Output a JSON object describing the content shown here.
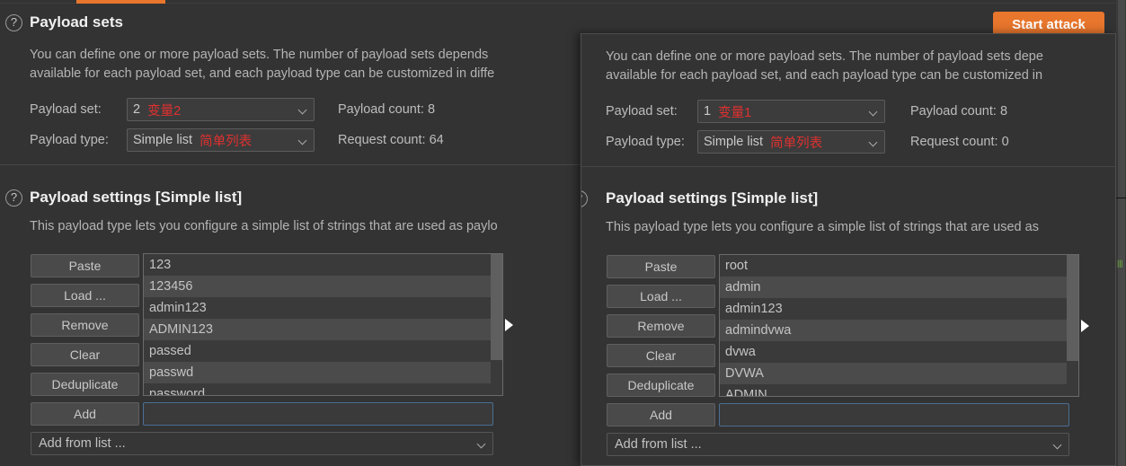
{
  "app": {
    "theme_bg": "#333333",
    "accent": "#e8762c",
    "highlight_red": "#e03030"
  },
  "toolbar": {
    "start_attack_label": "Start attack"
  },
  "base_panel": {
    "payload_sets": {
      "help_icon": "question-mark-icon",
      "title": "Payload sets",
      "description_line1": "You can define one or more payload sets. The number of payload sets depends",
      "description_line2": "available for each payload set, and each payload type can be customized in diffe",
      "payload_set_label": "Payload set:",
      "payload_set_value_num": "2",
      "payload_set_value_cn": "变量2",
      "payload_type_label": "Payload type:",
      "payload_type_value": "Simple list",
      "payload_type_value_cn": "简单列表",
      "payload_count": "Payload count: 8",
      "request_count": "Request count: 64"
    },
    "payload_settings": {
      "help_icon": "question-mark-icon",
      "title": "Payload settings [Simple list]",
      "description": "This payload type lets you configure a simple list of strings that are used as paylo",
      "buttons": [
        "Paste",
        "Load ...",
        "Remove",
        "Clear",
        "Deduplicate",
        "Add"
      ],
      "payloads": [
        "123",
        "123456",
        "admin123",
        "ADMIN123",
        "passed",
        "passwd",
        "password"
      ],
      "add_input_value": "",
      "add_from_list_label": "Add from list ...",
      "expand_icon": "triangle-right-icon"
    }
  },
  "overlay_panel": {
    "payload_sets": {
      "description_line1": "You can define one or more payload sets. The number of payload sets depe",
      "description_line2": "available for each payload set, and each payload type can be customized in",
      "payload_set_label": "Payload set:",
      "payload_set_value_num": "1",
      "payload_set_value_cn": "变量1",
      "payload_type_label": "Payload type:",
      "payload_type_value": "Simple list",
      "payload_type_value_cn": "简单列表",
      "payload_count": "Payload count: 8",
      "request_count": "Request count: 0"
    },
    "payload_settings": {
      "help_icon": "question-mark-icon",
      "title": "Payload settings [Simple list]",
      "description": "This payload type lets you configure a simple list of strings that are used as",
      "buttons": [
        "Paste",
        "Load ...",
        "Remove",
        "Clear",
        "Deduplicate",
        "Add"
      ],
      "payloads": [
        "root",
        "admin",
        "admin123",
        "admindvwa",
        "dvwa",
        "DVWA",
        "ADMIN"
      ],
      "add_input_value": "",
      "add_from_list_label": "Add from list ...",
      "expand_icon": "triangle-right-icon"
    }
  }
}
